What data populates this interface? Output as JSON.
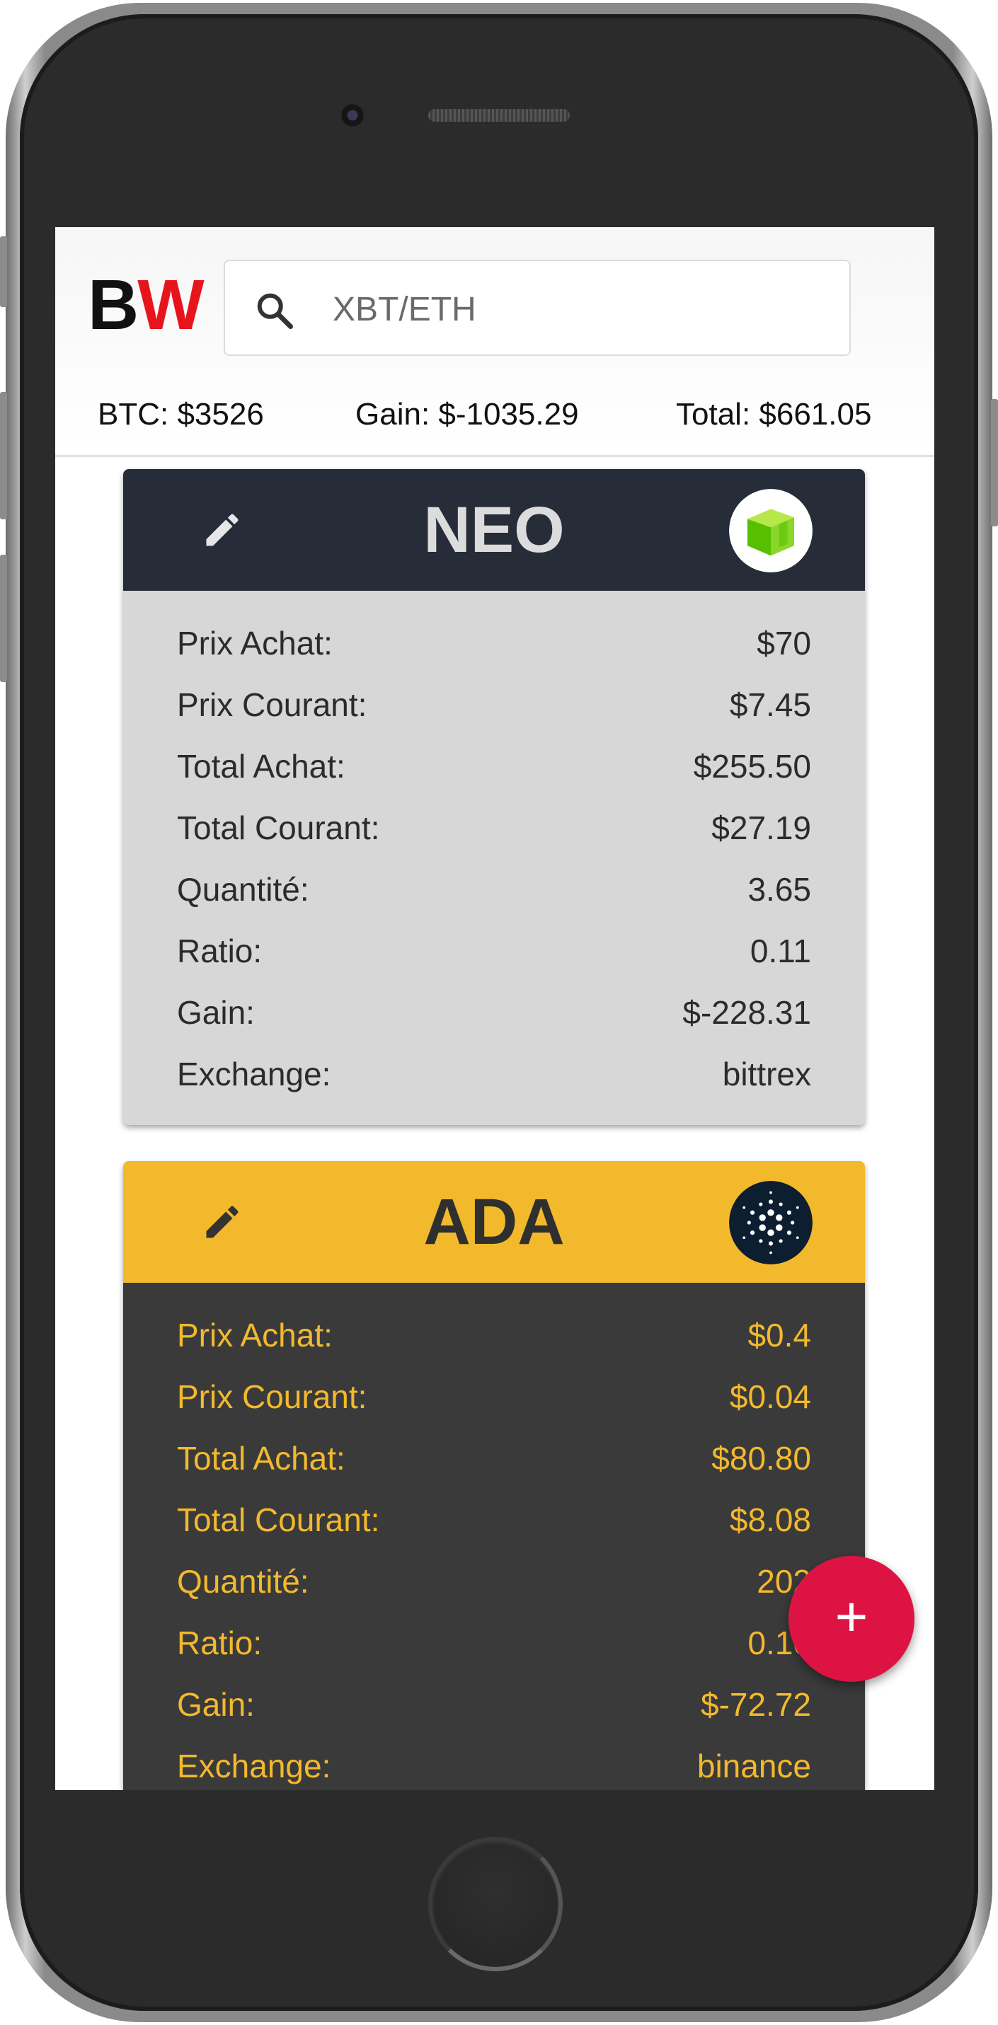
{
  "header": {
    "logo_b": "B",
    "logo_w": "W",
    "search_placeholder": "XBT/ETH",
    "btc": "BTC: $3526",
    "gain": "Gain: $-1035.29",
    "total": "Total: $661.05"
  },
  "colors": {
    "logo_red": "#e8141c",
    "neo_header": "#262d38",
    "neo_body": "#d7d7d7",
    "ada_header": "#f3b92d",
    "ada_body": "#3a3a3a",
    "fab": "#dd1443"
  },
  "cards": [
    {
      "symbol": "NEO",
      "icon": "neo-coin-icon",
      "rows": [
        {
          "label": "Prix Achat:",
          "value": "$70"
        },
        {
          "label": "Prix Courant:",
          "value": "$7.45"
        },
        {
          "label": "Total Achat:",
          "value": "$255.50"
        },
        {
          "label": "Total Courant:",
          "value": "$27.19"
        },
        {
          "label": "Quantité:",
          "value": "3.65"
        },
        {
          "label": "Ratio:",
          "value": "0.11"
        },
        {
          "label": "Gain:",
          "value": "$-228.31"
        },
        {
          "label": "Exchange:",
          "value": "bittrex"
        }
      ]
    },
    {
      "symbol": "ADA",
      "icon": "cardano-coin-icon",
      "rows": [
        {
          "label": "Prix Achat:",
          "value": "$0.4"
        },
        {
          "label": "Prix Courant:",
          "value": "$0.04"
        },
        {
          "label": "Total Achat:",
          "value": "$80.80"
        },
        {
          "label": "Total Courant:",
          "value": "$8.08"
        },
        {
          "label": "Quantité:",
          "value": "202"
        },
        {
          "label": "Ratio:",
          "value": "0.10"
        },
        {
          "label": "Gain:",
          "value": "$-72.72"
        },
        {
          "label": "Exchange:",
          "value": "binance"
        }
      ]
    }
  ],
  "fab": {
    "label": "+"
  }
}
